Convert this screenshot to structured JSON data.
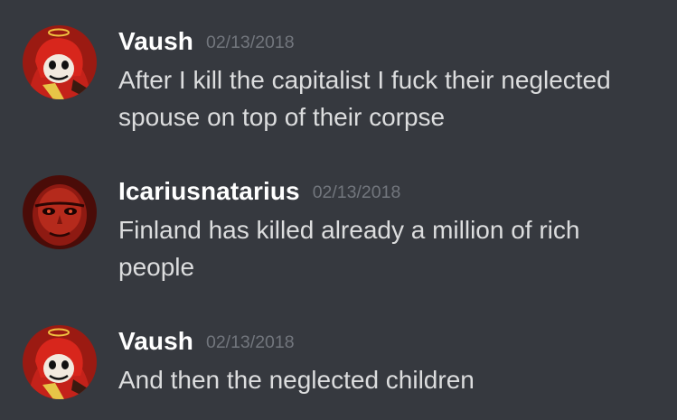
{
  "messages": [
    {
      "author": "Vaush",
      "timestamp": "02/13/2018",
      "lines": [
        "After I kill the capitalist I fuck their neglected",
        "spouse on top of their corpse"
      ],
      "avatar": "red-hooded-cartoon-avatar"
    },
    {
      "author": "Icariusnatarius",
      "timestamp": "02/13/2018",
      "lines": [
        "Finland has killed already a million of rich",
        "people"
      ],
      "avatar": "red-tinted-face-avatar"
    },
    {
      "author": "Vaush",
      "timestamp": "02/13/2018",
      "lines": [
        "And then the neglected children"
      ],
      "avatar": "red-hooded-cartoon-avatar"
    }
  ],
  "colors": {
    "background": "#36393f",
    "username": "#ffffff",
    "timestamp": "#72767d",
    "message_text": "#dcddde"
  }
}
